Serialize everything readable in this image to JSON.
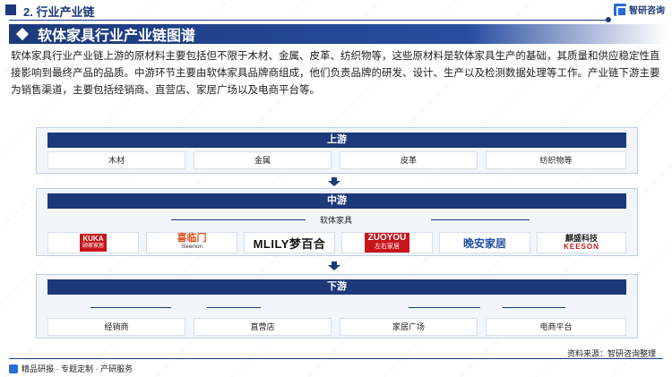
{
  "header": {
    "section": "2. 行业产业链",
    "logo_text": "智研咨询"
  },
  "title": "软体家具行业产业链图谱",
  "intro": "软体家具行业产业链上游的原材料主要包括但不限于木材、金属、皮革、纺织物等，这些原材料是软体家具生产的基础，其质量和供应稳定性直接影响到最终产品的品质。中游环节主要由软体家具品牌商组成，他们负责品牌的研发、设计、生产以及检测数据处理等工作。产业链下游主要为销售渠道，主要包括经销商、直营店、家居广场以及电商平台等。",
  "upstream": {
    "title": "上游",
    "items": [
      "木材",
      "金属",
      "皮革",
      "纺织物等"
    ]
  },
  "midstream": {
    "title": "中游",
    "subtitle": "软体家具",
    "brands": [
      {
        "name": "KUKA",
        "sub": "顾家家居"
      },
      {
        "name": "喜临门",
        "sub": "Sleemon"
      },
      {
        "name": "MLILY梦百合",
        "sub": ""
      },
      {
        "name": "ZUOYOU",
        "sub": "左右家居"
      },
      {
        "name": "晚安家居",
        "sub": ""
      },
      {
        "name": "麒盛科技",
        "sub": "KEESON"
      }
    ]
  },
  "downstream": {
    "title": "下游",
    "items": [
      "经销商",
      "直营店",
      "家居广场",
      "电商平台"
    ]
  },
  "footer": {
    "left": "精品研报 · 专题定制 · 产研服务",
    "source": "资料来源：智研咨询整理"
  },
  "colors": {
    "primary": "#1c3a7a",
    "accent": "#2a6bd8",
    "panel": "#f2f6fb"
  }
}
